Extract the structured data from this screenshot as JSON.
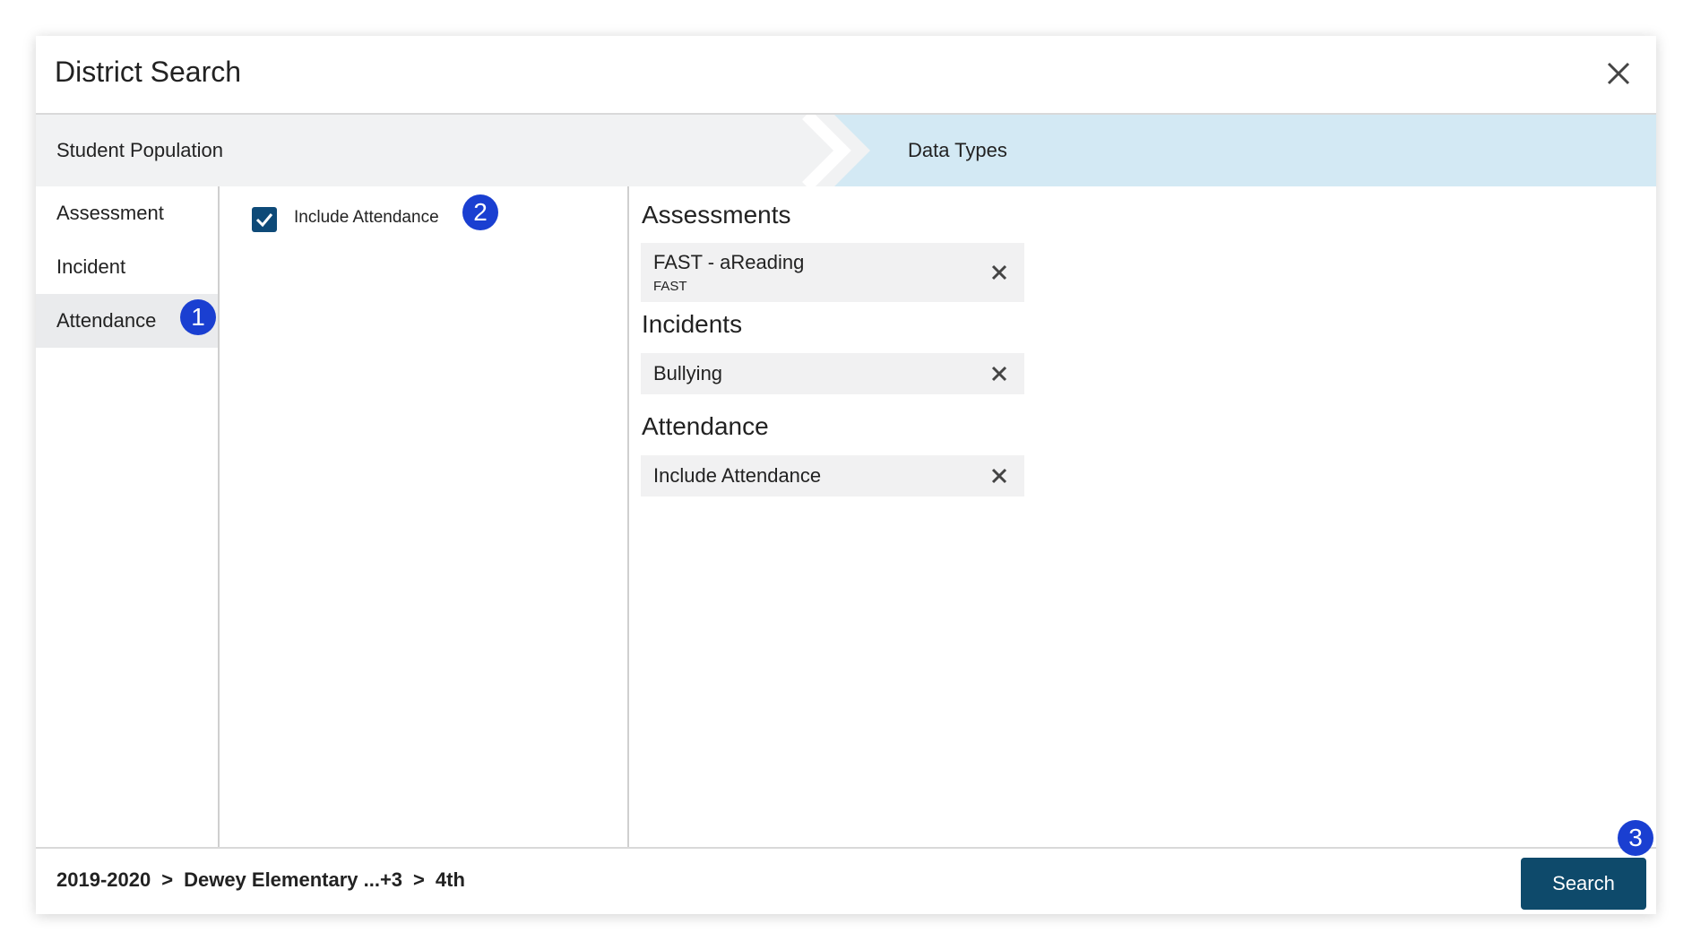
{
  "modal": {
    "title": "District Search"
  },
  "steps": [
    {
      "label": "Student Population"
    },
    {
      "label": "Data Types"
    }
  ],
  "nav": {
    "items": [
      {
        "label": "Assessment"
      },
      {
        "label": "Incident"
      },
      {
        "label": "Attendance"
      }
    ]
  },
  "options": {
    "include_attendance_label": "Include Attendance",
    "include_attendance_checked": true
  },
  "summary": {
    "assessments_title": "Assessments",
    "assessment_chip": {
      "label": "FAST - aReading",
      "sub": "FAST"
    },
    "incidents_title": "Incidents",
    "incident_chip": {
      "label": "Bullying"
    },
    "attendance_title": "Attendance",
    "attendance_chip": {
      "label": "Include Attendance"
    }
  },
  "footer": {
    "breadcrumb": [
      "2019-2020",
      "Dewey Elementary ...+3",
      "4th"
    ],
    "separator": ">",
    "search_label": "Search"
  },
  "badges": [
    "1",
    "2",
    "3"
  ],
  "colors": {
    "primary": "#0e4a6b",
    "checkbox": "#0e4a78",
    "active_step": "#d3e9f4",
    "badge": "#1a3fd1"
  }
}
